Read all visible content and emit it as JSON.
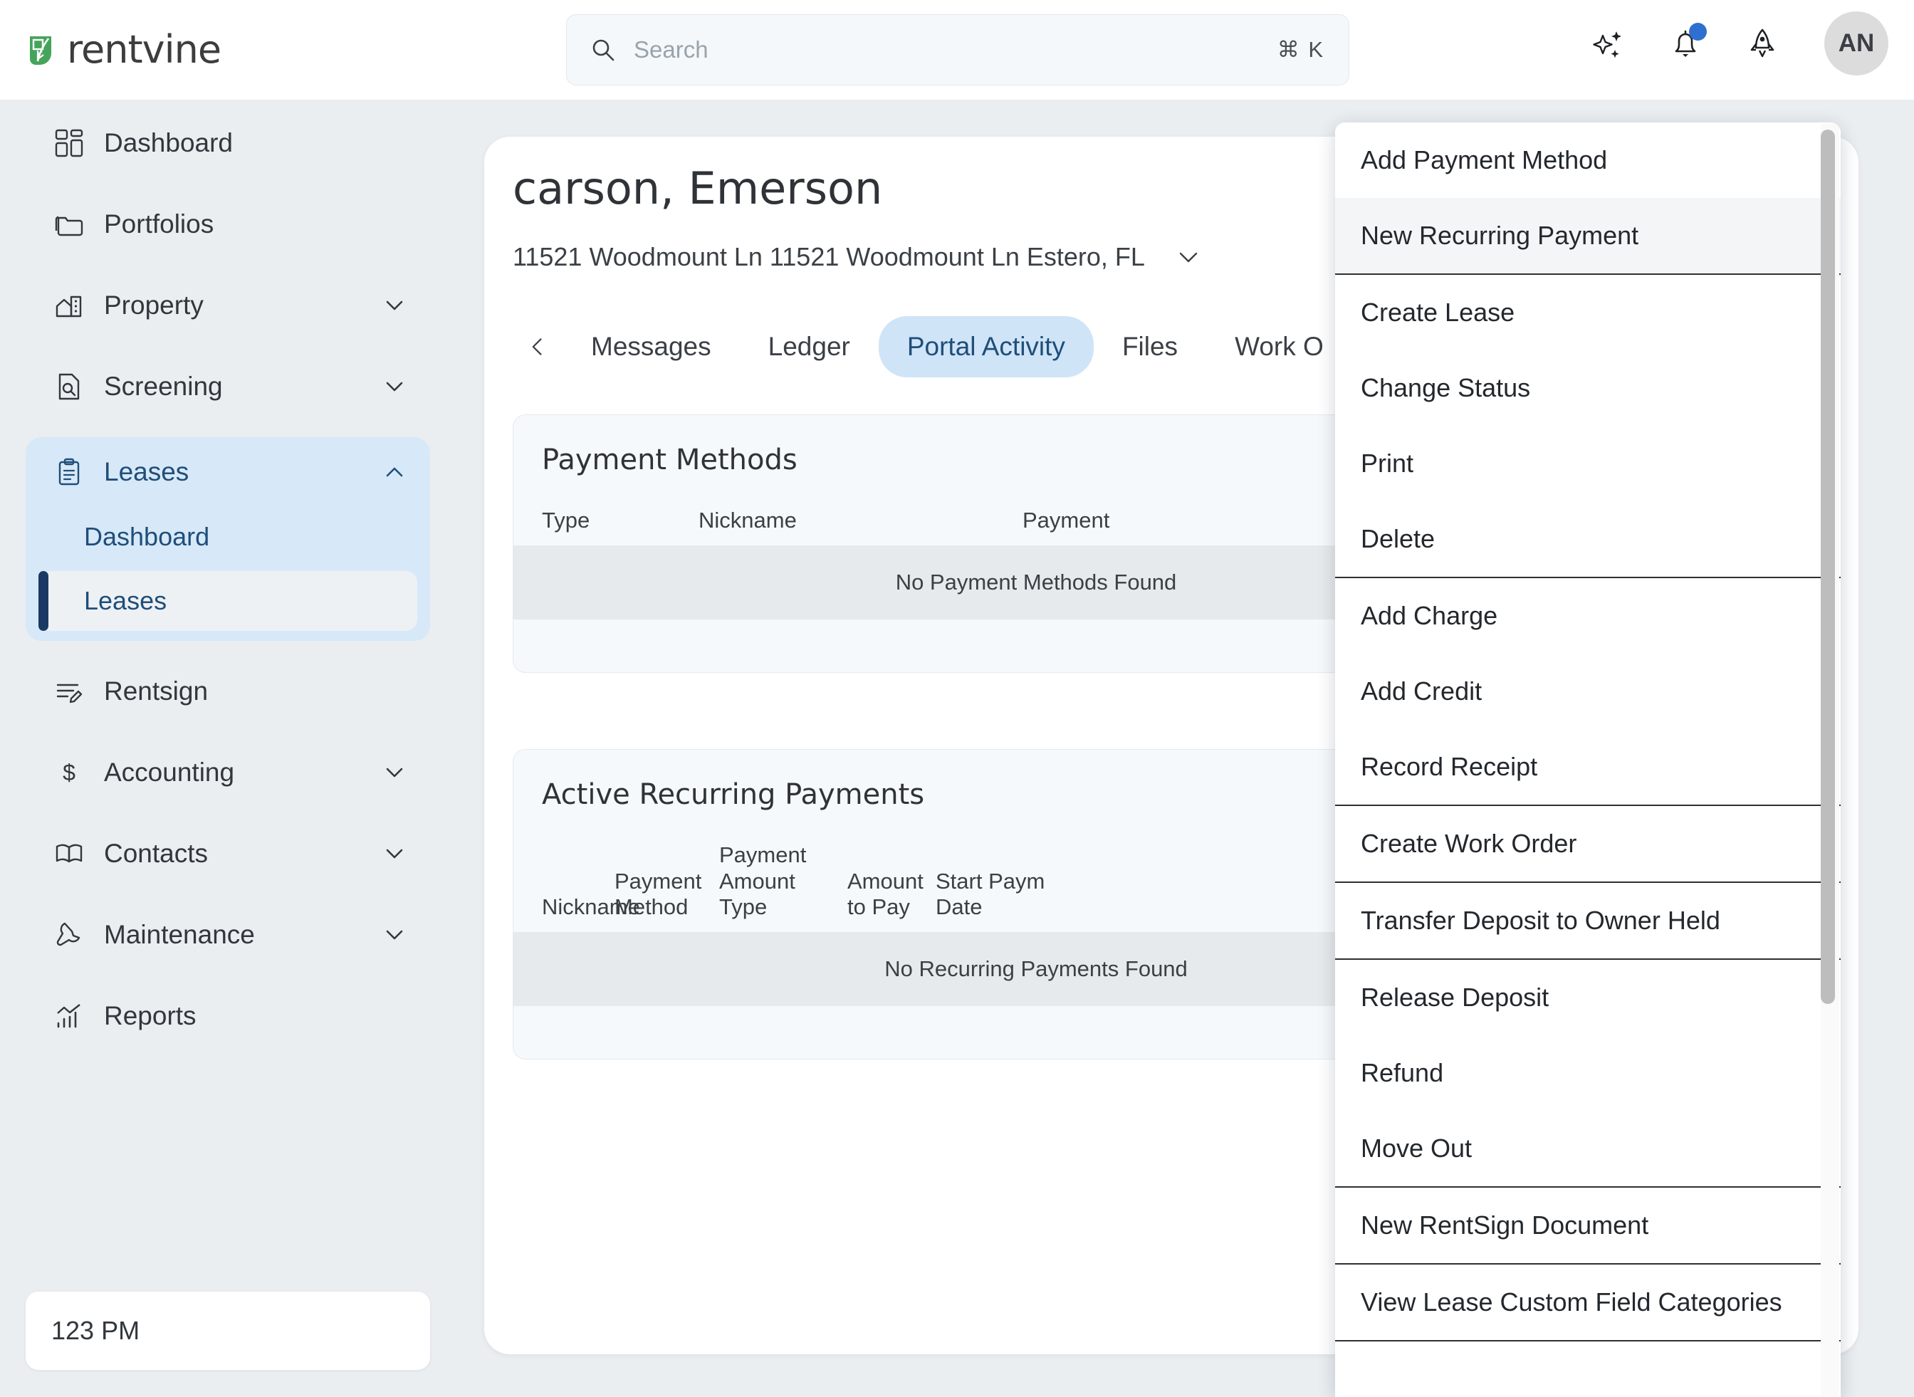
{
  "brand": {
    "name": "rentvine"
  },
  "search": {
    "placeholder": "Search",
    "shortcut": "⌘ K"
  },
  "topbar": {
    "icons": [
      "sparkles-icon",
      "bell-icon",
      "rocket-icon"
    ],
    "avatar_initials": "AN"
  },
  "sidebar": {
    "items": [
      {
        "label": "Dashboard",
        "icon": "dashboard-icon",
        "expandable": false
      },
      {
        "label": "Portfolios",
        "icon": "folder-icon",
        "expandable": false
      },
      {
        "label": "Property",
        "icon": "building-icon",
        "expandable": true
      },
      {
        "label": "Screening",
        "icon": "document-search-icon",
        "expandable": true
      }
    ],
    "leases_group": {
      "label": "Leases",
      "icon": "clipboard-icon",
      "expanded": true,
      "sub_items": [
        {
          "label": "Dashboard",
          "active": false
        },
        {
          "label": "Leases",
          "active": true
        }
      ]
    },
    "items_after": [
      {
        "label": "Rentsign",
        "icon": "signature-icon",
        "expandable": false
      },
      {
        "label": "Accounting",
        "icon": "dollar-icon",
        "expandable": true
      },
      {
        "label": "Contacts",
        "icon": "book-icon",
        "expandable": true
      },
      {
        "label": "Maintenance",
        "icon": "wrench-icon",
        "expandable": true
      },
      {
        "label": "Reports",
        "icon": "chart-icon",
        "expandable": false
      }
    ],
    "clock": "123 PM"
  },
  "main": {
    "title": "carson, Emerson",
    "address": "11521 Woodmount Ln 11521 Woodmount Ln Estero, FL",
    "tabs": [
      {
        "label": "Messages",
        "active": false
      },
      {
        "label": "Ledger",
        "active": false
      },
      {
        "label": "Portal Activity",
        "active": true
      },
      {
        "label": "Files",
        "active": false
      },
      {
        "label": "Work O",
        "active": false
      }
    ],
    "payment_methods": {
      "title": "Payment Methods",
      "columns": [
        "Type",
        "Nickname",
        "Payment"
      ],
      "empty_text": "No Payment Methods Found"
    },
    "recurring_payments": {
      "title": "Active Recurring Payments",
      "columns": [
        "Nickname",
        "Payment Method",
        "Payment Amount Type",
        "Amount to Pay",
        "Start Paym Date"
      ],
      "empty_text": "No Recurring Payments Found"
    }
  },
  "menu": {
    "items": [
      {
        "label": "Add Payment Method",
        "hover": false,
        "sep_after": false
      },
      {
        "label": "New Recurring Payment",
        "hover": true,
        "sep_after": true
      },
      {
        "label": "Create Lease",
        "hover": false,
        "sep_after": false
      },
      {
        "label": "Change Status",
        "hover": false,
        "sep_after": false
      },
      {
        "label": "Print",
        "hover": false,
        "sep_after": false
      },
      {
        "label": "Delete",
        "hover": false,
        "sep_after": true
      },
      {
        "label": "Add Charge",
        "hover": false,
        "sep_after": false
      },
      {
        "label": "Add Credit",
        "hover": false,
        "sep_after": false
      },
      {
        "label": "Record Receipt",
        "hover": false,
        "sep_after": true
      },
      {
        "label": "Create Work Order",
        "hover": false,
        "sep_after": true
      },
      {
        "label": "Transfer Deposit to Owner Held",
        "hover": false,
        "sep_after": true
      },
      {
        "label": "Release Deposit",
        "hover": false,
        "sep_after": false
      },
      {
        "label": "Refund",
        "hover": false,
        "sep_after": false
      },
      {
        "label": "Move Out",
        "hover": false,
        "sep_after": true
      },
      {
        "label": "New RentSign Document",
        "hover": false,
        "sep_after": true
      },
      {
        "label": "View Lease Custom Field Categories",
        "hover": false,
        "sep_after": true
      }
    ]
  },
  "colors": {
    "accent_blue": "#1f4e79",
    "active_pill": "#cfe4f7",
    "brand_green": "#45a45c",
    "notification": "#2f6fd0",
    "page_bg": "#eaeef1"
  }
}
